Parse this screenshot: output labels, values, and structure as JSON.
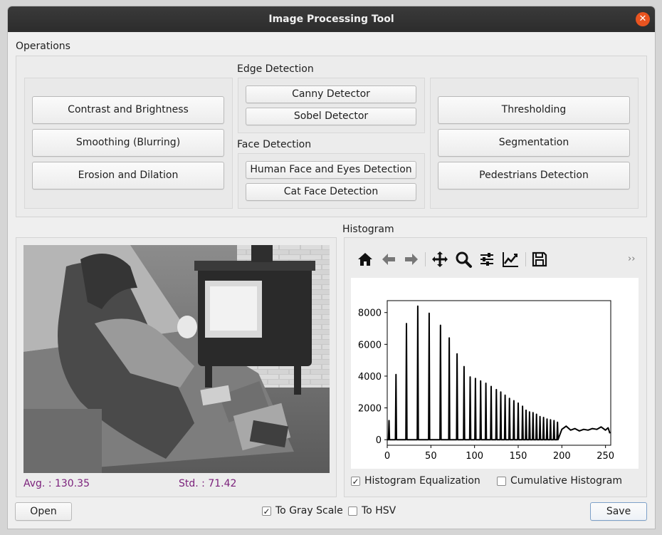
{
  "window": {
    "title": "Image Processing Tool"
  },
  "operations": {
    "label": "Operations",
    "left_buttons": [
      "Contrast and Brightness",
      "Smoothing (Blurring)",
      "Erosion and Dilation"
    ],
    "edge_detection": {
      "label": "Edge Detection",
      "buttons": [
        "Canny Detector",
        "Sobel Detector"
      ]
    },
    "face_detection": {
      "label": "Face Detection",
      "buttons": [
        "Human Face and Eyes Detection",
        "Cat Face Detection"
      ]
    },
    "right_buttons": [
      "Thresholding",
      "Segmentation",
      "Pedestrians Detection"
    ]
  },
  "image_panel": {
    "avg": "Avg. : 130.35",
    "std": "Std. : 71.42"
  },
  "histogram": {
    "label": "Histogram",
    "toolbar": [
      "home-icon",
      "back-arrow-icon",
      "forward-arrow-icon",
      "pan-icon",
      "zoom-icon",
      "configure-subplots-icon",
      "edit-axis-icon",
      "save-icon"
    ],
    "overflow": "››",
    "equalization": {
      "label": "Histogram Equalization",
      "checked": true
    },
    "cumulative": {
      "label": "Cumulative Histogram",
      "checked": false
    }
  },
  "chart_data": {
    "type": "line",
    "title": "",
    "xlabel": "",
    "ylabel": "",
    "xlim": [
      0,
      256
    ],
    "ylim": [
      -350,
      8750
    ],
    "xticks": [
      0,
      50,
      100,
      150,
      200,
      250
    ],
    "yticks": [
      0,
      2000,
      4000,
      6000,
      8000
    ],
    "series_color": "#000000",
    "spikes": [
      {
        "x": 2,
        "y": 1200
      },
      {
        "x": 10,
        "y": 4100
      },
      {
        "x": 22,
        "y": 7300
      },
      {
        "x": 35,
        "y": 8400
      },
      {
        "x": 48,
        "y": 7950
      },
      {
        "x": 61,
        "y": 7200
      },
      {
        "x": 71,
        "y": 6400
      },
      {
        "x": 80,
        "y": 5400
      },
      {
        "x": 88,
        "y": 4600
      },
      {
        "x": 95,
        "y": 3950
      },
      {
        "x": 101,
        "y": 3850
      },
      {
        "x": 107,
        "y": 3700
      },
      {
        "x": 113,
        "y": 3550
      },
      {
        "x": 119,
        "y": 3350
      },
      {
        "x": 125,
        "y": 3150
      },
      {
        "x": 130,
        "y": 3000
      },
      {
        "x": 135,
        "y": 2800
      },
      {
        "x": 140,
        "y": 2600
      },
      {
        "x": 145,
        "y": 2450
      },
      {
        "x": 150,
        "y": 2300
      },
      {
        "x": 155,
        "y": 2100
      },
      {
        "x": 159,
        "y": 1850
      },
      {
        "x": 163,
        "y": 1750
      },
      {
        "x": 167,
        "y": 1700
      },
      {
        "x": 171,
        "y": 1600
      },
      {
        "x": 175,
        "y": 1450
      },
      {
        "x": 179,
        "y": 1400
      },
      {
        "x": 183,
        "y": 1300
      },
      {
        "x": 187,
        "y": 1250
      },
      {
        "x": 191,
        "y": 1200
      },
      {
        "x": 195,
        "y": 1100
      }
    ],
    "tail": [
      [
        200,
        650
      ],
      [
        205,
        850
      ],
      [
        210,
        600
      ],
      [
        215,
        700
      ],
      [
        220,
        550
      ],
      [
        225,
        650
      ],
      [
        230,
        600
      ],
      [
        235,
        700
      ],
      [
        240,
        650
      ],
      [
        245,
        800
      ],
      [
        250,
        600
      ],
      [
        253,
        750
      ],
      [
        255,
        400
      ]
    ]
  },
  "bottom": {
    "open_label": "Open",
    "gray": {
      "label": "To Gray Scale",
      "checked": true
    },
    "hsv": {
      "label": "To HSV",
      "checked": false
    },
    "save_label": "Save"
  }
}
